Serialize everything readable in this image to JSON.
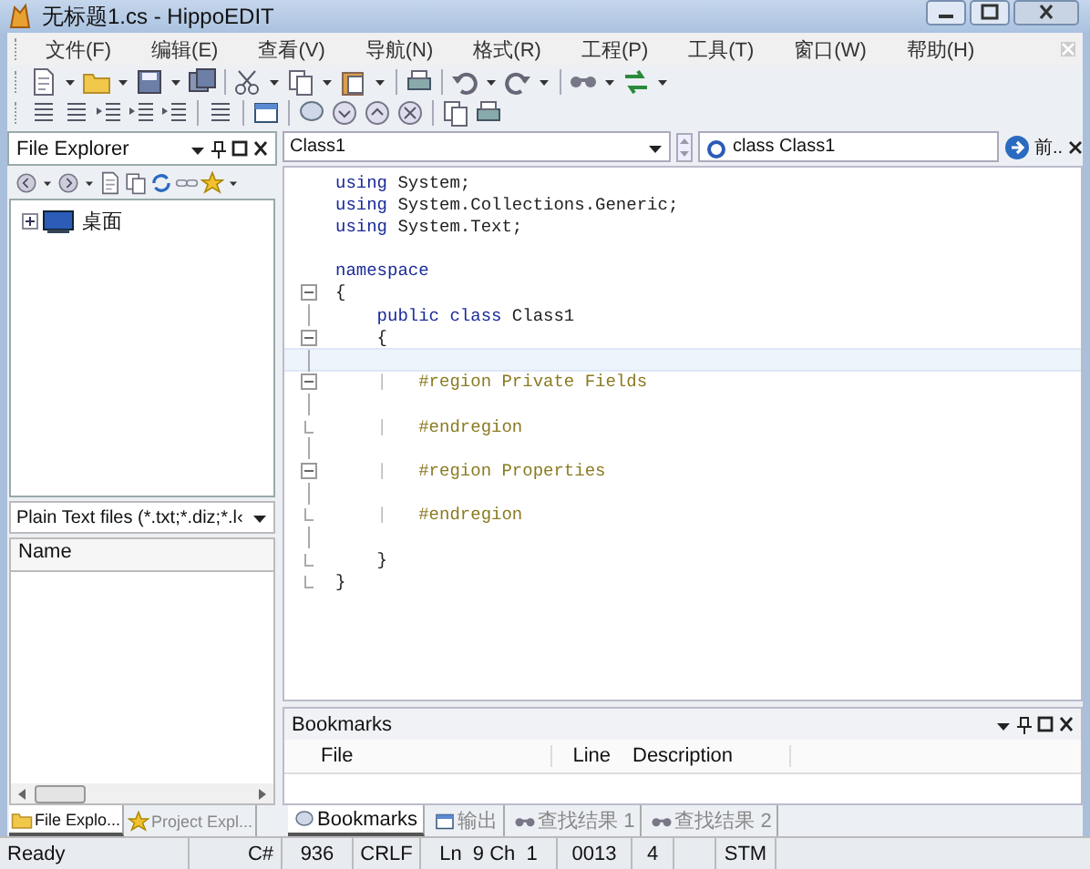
{
  "window": {
    "title": "无标题1.cs - HippoEDIT"
  },
  "menu": [
    "文件(F)",
    "编辑(E)",
    "查看(V)",
    "导航(N)",
    "格式(R)",
    "工程(P)",
    "工具(T)",
    "窗口(W)",
    "帮助(H)"
  ],
  "left_panel": {
    "title": "File Explorer",
    "tree": [
      {
        "label": "桌面",
        "expanded": false
      }
    ],
    "filter": "Plain Text files (*.txt;*.diz;*.l‹",
    "column": "Name",
    "tabs": [
      {
        "label": "File Explo...",
        "selected": true
      },
      {
        "label": "Project Expl...",
        "selected": false
      }
    ]
  },
  "editor": {
    "scope": "Class1",
    "member": "class Class1",
    "nav": "前..",
    "lines": [
      {
        "kind": "plain",
        "current": false,
        "tokens": [
          {
            "kind": "keyword",
            "text": "using"
          },
          {
            "kind": "plain",
            "text": " System;"
          }
        ]
      },
      {
        "kind": "plain",
        "current": false,
        "tokens": [
          {
            "kind": "keyword",
            "text": "using"
          },
          {
            "kind": "plain",
            "text": " System.Collections.Generic;"
          }
        ]
      },
      {
        "kind": "plain",
        "current": false,
        "tokens": [
          {
            "kind": "keyword",
            "text": "using"
          },
          {
            "kind": "plain",
            "text": " System.Text;"
          }
        ]
      },
      {
        "kind": "plain",
        "current": false
      },
      {
        "kind": "plain",
        "current": false,
        "tokens": [
          {
            "kind": "keyword",
            "text": "namespace"
          }
        ]
      },
      {
        "kind": "fold-start",
        "current": false,
        "tokens": [
          {
            "kind": "plain",
            "text": "{"
          }
        ]
      },
      {
        "kind": "fold-line",
        "current": false,
        "tokens": [
          {
            "kind": "keyword",
            "text": "    public class"
          },
          {
            "kind": "plain",
            "text": " Class1"
          }
        ]
      },
      {
        "kind": "fold-start",
        "current": false,
        "tokens": [
          {
            "kind": "plain",
            "text": "    {"
          }
        ]
      },
      {
        "kind": "fold-line",
        "current": true
      },
      {
        "kind": "fold-start",
        "current": false,
        "tokens": [
          {
            "kind": "guide",
            "text": "    |   "
          },
          {
            "kind": "directive",
            "text": "#region Private Fields"
          }
        ]
      },
      {
        "kind": "fold-line",
        "current": false
      },
      {
        "kind": "fold-end",
        "current": false,
        "tokens": [
          {
            "kind": "guide",
            "text": "    |   "
          },
          {
            "kind": "directive",
            "text": "#endregion"
          }
        ]
      },
      {
        "kind": "fold-line",
        "current": false
      },
      {
        "kind": "fold-start",
        "current": false,
        "tokens": [
          {
            "kind": "guide",
            "text": "    |   "
          },
          {
            "kind": "directive",
            "text": "#region Properties"
          }
        ]
      },
      {
        "kind": "fold-line",
        "current": false
      },
      {
        "kind": "fold-end",
        "current": false,
        "tokens": [
          {
            "kind": "guide",
            "text": "    |   "
          },
          {
            "kind": "directive",
            "text": "#endregion"
          }
        ]
      },
      {
        "kind": "fold-line",
        "current": false
      },
      {
        "kind": "fold-end",
        "current": false,
        "tokens": [
          {
            "kind": "plain",
            "text": "    }"
          }
        ]
      },
      {
        "kind": "fold-end",
        "current": false,
        "tokens": [
          {
            "kind": "plain",
            "text": "}"
          }
        ]
      }
    ]
  },
  "bookmarks": {
    "title": "Bookmarks",
    "columns": [
      "File",
      "Line",
      "Description"
    ],
    "tabs": [
      {
        "label": "Bookmarks",
        "selected": true
      },
      {
        "label": "输出",
        "selected": false
      },
      {
        "label": "查找结果 1",
        "selected": false
      },
      {
        "label": "查找结果 2",
        "selected": false
      }
    ]
  },
  "status_bar": [
    "Ready",
    "C#",
    "936",
    "CRLF",
    "Ln  9 Ch  1",
    "0013",
    "4",
    "STM"
  ]
}
